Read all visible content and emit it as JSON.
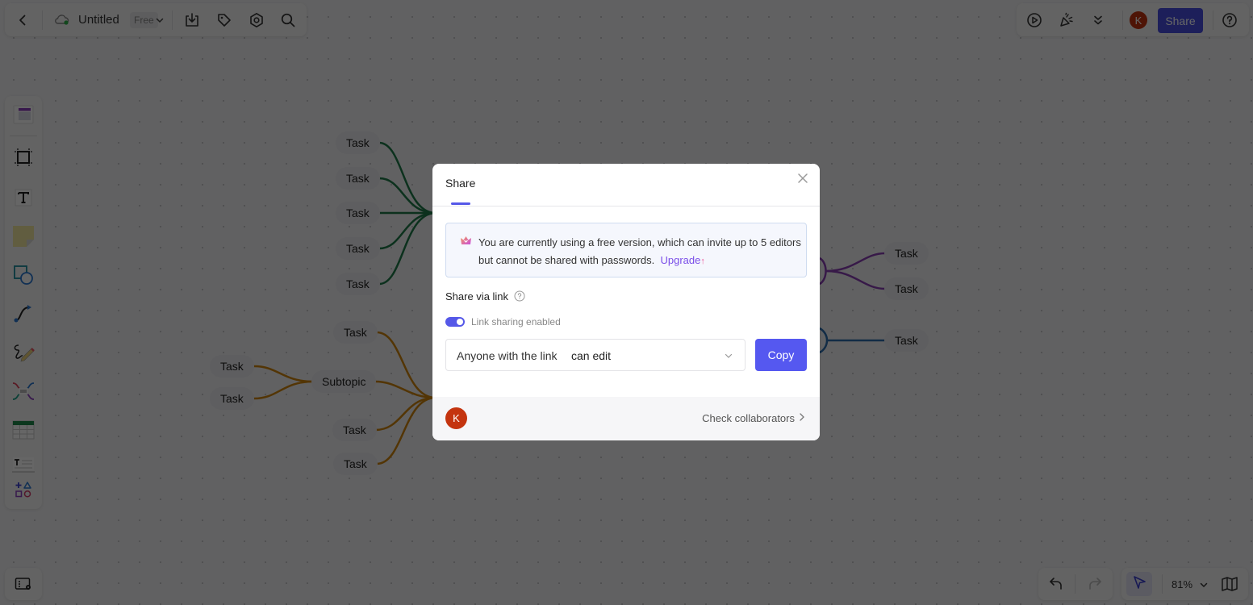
{
  "topbar_left": {
    "back_icon": "chevron-left-icon",
    "cloud_icon": "cloud-synced-icon",
    "title": "Untitled",
    "plan_badge": "Free",
    "dropdown_icon": "chevron-down-icon",
    "actions": [
      "download-icon",
      "tag-icon",
      "settings-icon",
      "search-icon"
    ]
  },
  "topbar_right": {
    "actions": [
      "present-icon",
      "celebrate-icon",
      "expand-more-icon"
    ],
    "user_initial": "K",
    "share_label": "Share",
    "help_icon": "help-icon"
  },
  "toolbar_left": {
    "tools": [
      "template",
      "frame",
      "text",
      "sticky-note",
      "shapes",
      "connector",
      "pen",
      "mind-map",
      "table",
      "text-list",
      "more-shapes"
    ]
  },
  "bottom_bar": {
    "zoom_level": "81%",
    "undo_icon": "undo-icon",
    "redo_icon": "redo-icon",
    "select_icon": "pointer-icon",
    "map_icon": "minimap-icon",
    "outline_icon": "outline-icon"
  },
  "mindmap": {
    "green_branch": [
      "Task",
      "Task",
      "Task",
      "Task",
      "Task"
    ],
    "orange_branch": {
      "top": "Task",
      "subtopic": "Subtopic",
      "subtopic_children": [
        "Task",
        "Task"
      ],
      "bottom": [
        "Task",
        "Task"
      ]
    },
    "purple_branch": [
      "Task",
      "Task"
    ],
    "blue_branch": [
      "Task"
    ]
  },
  "colors": {
    "accent": "#5558e8",
    "green_branch": "#1e7a4a",
    "orange_branch": "#d0850d",
    "purple_branch": "#8a3fb5",
    "blue_branch": "#2f6fb0",
    "avatar": "#c4340f"
  },
  "share_modal": {
    "title": "Share",
    "notice": "You are currently using a free version, which can invite up to 5 editors but cannot be shared with passwords.",
    "upgrade_label": "Upgrade",
    "share_via_link_label": "Share via link",
    "toggle_label": "Link sharing enabled",
    "toggle_on": true,
    "permission_prefix": "Anyone with the link",
    "permission_value": "can edit",
    "copy_label": "Copy",
    "collaborator_initial": "K",
    "check_collaborators_label": "Check collaborators"
  }
}
